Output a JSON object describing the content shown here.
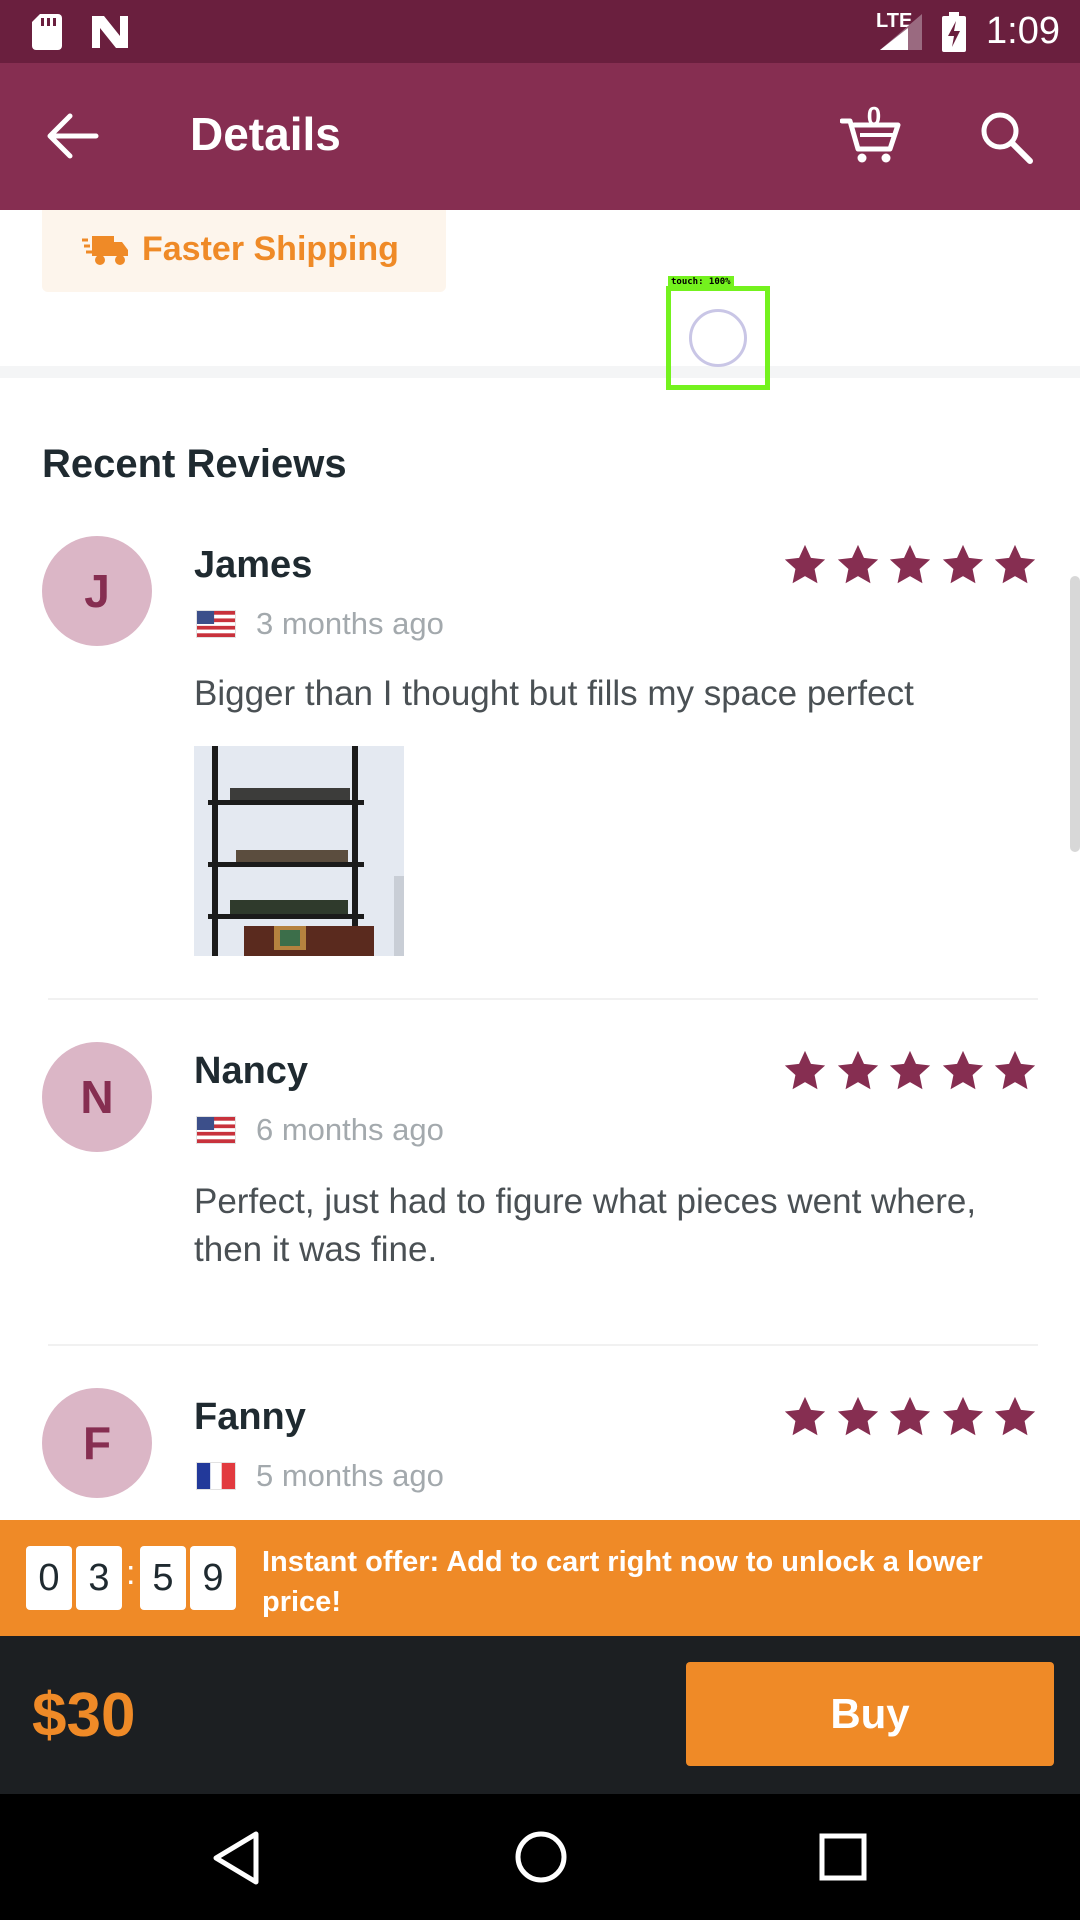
{
  "status_bar": {
    "network": "LTE",
    "time": "1:09"
  },
  "app_bar": {
    "title": "Details",
    "cart_count": "0"
  },
  "shipping": {
    "label": "Faster Shipping"
  },
  "touch_overlay": {
    "label": "touch: 100%"
  },
  "reviews_section": {
    "title": "Recent Reviews"
  },
  "reviews": [
    {
      "initial": "J",
      "name": "James",
      "flag": "us-flag-icon",
      "when": "3 months ago",
      "rating": 5,
      "text": "Bigger than I thought but fills my space perfect",
      "has_photo": true
    },
    {
      "initial": "N",
      "name": "Nancy",
      "flag": "us-flag-icon",
      "when": "6 months ago",
      "rating": 5,
      "text": "Perfect, just had to figure what pieces went where, then it was fine."
    },
    {
      "initial": "F",
      "name": "Fanny",
      "flag": "fr-flag-icon",
      "when": "5 months ago",
      "rating": 5
    }
  ],
  "offer": {
    "timer_digits": [
      "0",
      "3",
      "5",
      "9"
    ],
    "separator": ":",
    "text": "Instant offer: Add to cart right now to unlock a lower price!"
  },
  "purchase": {
    "price": "$30",
    "buy_label": "Buy"
  },
  "colors": {
    "primary": "#862e51",
    "status": "#6a1f3e",
    "accent": "#ef8a27",
    "star": "#862e51",
    "dark": "#1c1f22"
  }
}
